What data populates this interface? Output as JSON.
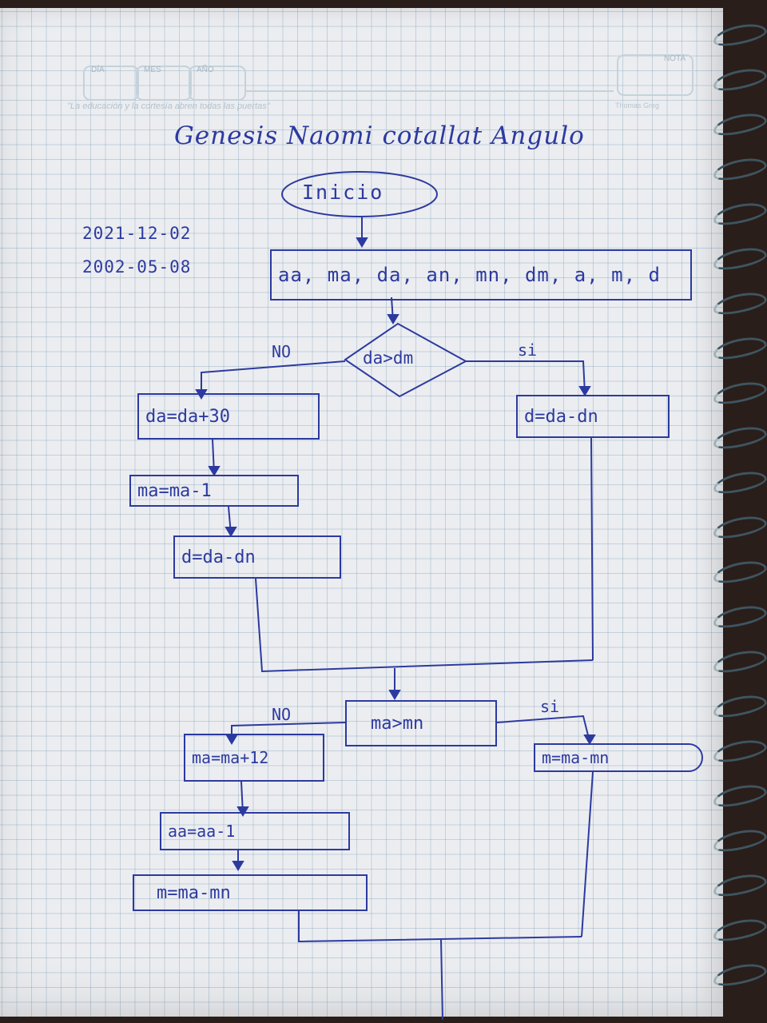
{
  "header": {
    "dia_label": "DÍA",
    "mes_label": "MES",
    "ano_label": "AÑO",
    "nota_label": "NOTA",
    "motto": "\"La educación y la cortesía abren todas las puertas\"",
    "brand": "Thomas Greg"
  },
  "author_name": "Genesis Naomi cotallat Angulo",
  "dates": [
    "2021-12-02",
    "2002-05-08"
  ],
  "flowchart": {
    "start": "Inicio",
    "input": "aa, ma, da, an, mn, dm, a, m, d",
    "decision1": "da>dm",
    "decision1_no": "NO",
    "decision1_yes": "si",
    "no_branch1": [
      "da=da+30",
      "ma=ma-1",
      "d=da-dn"
    ],
    "yes_branch1": "d=da-dn",
    "decision2": "ma>mn",
    "decision2_no": "NO",
    "decision2_yes": "si",
    "no_branch2": [
      "ma=ma+12",
      "aa=aa-1",
      "m=ma-mn"
    ],
    "yes_branch2": "m=ma-mn"
  }
}
